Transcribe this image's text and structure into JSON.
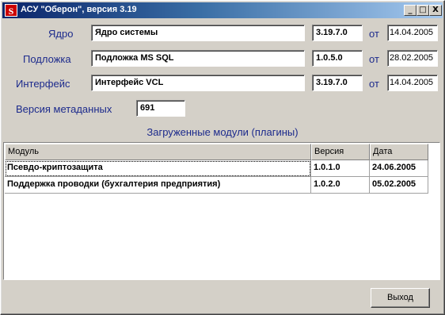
{
  "window": {
    "title": "АСУ \"Оберон\", версия 3.19",
    "app_icon_letter": "S",
    "minimize_glyph": "_",
    "maximize_glyph": "□",
    "close_glyph": "X"
  },
  "info": {
    "core": {
      "label": "Ядро",
      "name": "Ядро системы",
      "version": "3.19.7.0",
      "from": "от",
      "date": "14.04.2005"
    },
    "substrate": {
      "label": "Подложка",
      "name": "Подложка MS SQL",
      "version": "1.0.5.0",
      "from": "от",
      "date": "28.02.2005"
    },
    "interface": {
      "label": "Интерфейс",
      "name": "Интерфейс VCL",
      "version": "3.19.7.0",
      "from": "от",
      "date": "14.04.2005"
    },
    "metadata": {
      "label": "Версия метаданных",
      "value": "691"
    }
  },
  "modules": {
    "title": "Загруженные модули (плагины)",
    "columns": [
      "Модуль",
      "Версия",
      "Дата"
    ],
    "rows": [
      [
        "Псевдо-криптозащита",
        "1.0.1.0",
        "24.06.2005"
      ],
      [
        "Поддержка проводки (бухгалтерия предприятия)",
        "1.0.2.0",
        "05.02.2005"
      ]
    ]
  },
  "buttons": {
    "exit": "Выход"
  }
}
